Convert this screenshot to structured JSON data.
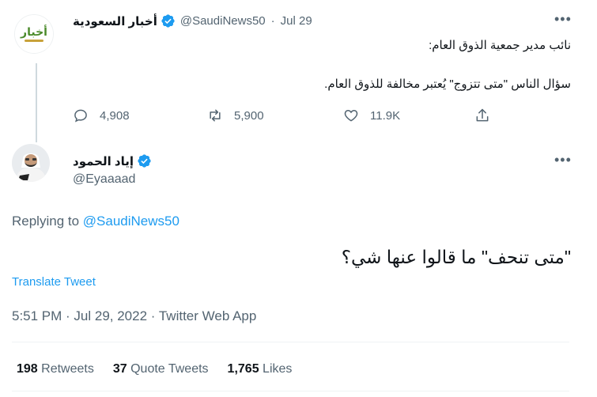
{
  "quoted_tweet": {
    "display_name": "أخبار السعودية",
    "handle": "@SaudiNews50",
    "separator": "·",
    "date": "Jul 29",
    "logo_text": "أخبار",
    "text_line1": "نائب مدير جمعية الذوق العام:",
    "text_line2": "سؤال الناس \"متى تتزوج\" يُعتبر مخالفة للذوق العام.",
    "replies": "4,908",
    "retweets": "5,900",
    "likes": "11.9K"
  },
  "main_tweet": {
    "display_name": "إياد الحمود",
    "handle": "@Eyaaaad",
    "replying_prefix": "Replying to",
    "replying_to": "@SaudiNews50",
    "text": "\"متى تنحف\" ما قالوا عنها شي؟",
    "translate": "Translate Tweet",
    "timestamp": "5:51 PM · Jul 29, 2022 · Twitter Web App",
    "stats": [
      {
        "num": "198",
        "label": "Retweets"
      },
      {
        "num": "37",
        "label": "Quote Tweets"
      },
      {
        "num": "1,765",
        "label": "Likes"
      }
    ]
  },
  "colors": {
    "accent": "#1d9bf0",
    "verified": "#1d9bf0",
    "muted": "#536471"
  },
  "icons": [
    "reply-icon",
    "retweet-icon",
    "like-icon",
    "share-icon",
    "verified-icon",
    "more-icon"
  ]
}
